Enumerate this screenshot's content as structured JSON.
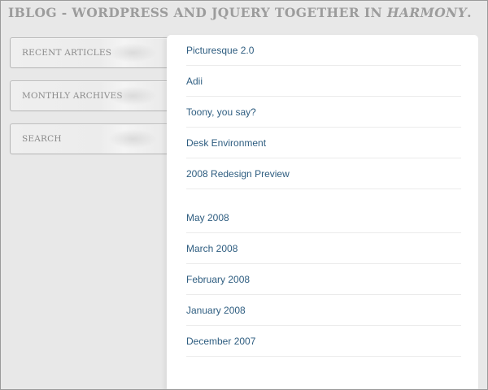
{
  "header": {
    "title_prefix": "IBLOG - WORDPRESS AND JQUERY TOGETHER IN ",
    "title_emphasis": "HARMONY",
    "title_suffix": "."
  },
  "sidebar": {
    "tabs": [
      {
        "label": "RECENT ARTICLES"
      },
      {
        "label": "MONTHLY ARCHIVES"
      },
      {
        "label": "SEARCH"
      }
    ]
  },
  "recent_articles": [
    {
      "label": "Picturesque 2.0"
    },
    {
      "label": "Adii"
    },
    {
      "label": "Toony, you say?"
    },
    {
      "label": "Desk Environment"
    },
    {
      "label": "2008 Redesign Preview"
    }
  ],
  "monthly_archives": [
    {
      "label": "May 2008"
    },
    {
      "label": "March 2008"
    },
    {
      "label": "February 2008"
    },
    {
      "label": "January 2008"
    },
    {
      "label": "December 2007"
    }
  ],
  "colors": {
    "background": "#e8e8e8",
    "title": "#9c9c9c",
    "link": "#2e5d80",
    "panel": "#ffffff"
  }
}
